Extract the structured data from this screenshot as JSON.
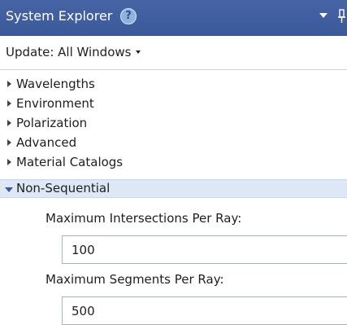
{
  "panel": {
    "title": "System Explorer",
    "help_glyph": "?",
    "icons": [
      "help-icon",
      "dropdown-arrow-icon",
      "pin-icon"
    ]
  },
  "update": {
    "label": "Update: All Windows"
  },
  "tree": {
    "items": [
      {
        "label": "Wavelengths",
        "expanded": false
      },
      {
        "label": "Environment",
        "expanded": false
      },
      {
        "label": "Polarization",
        "expanded": false
      },
      {
        "label": "Advanced",
        "expanded": false
      },
      {
        "label": "Material Catalogs",
        "expanded": false
      },
      {
        "label": "Non-Sequential",
        "expanded": true,
        "selected": true
      }
    ]
  },
  "non_sequential": {
    "max_intersections_label": "Maximum Intersections Per Ray:",
    "max_intersections_value": "100",
    "max_segments_label": "Maximum Segments Per Ray:",
    "max_segments_value": "500"
  },
  "colors": {
    "title_bar": "#3b5a9b",
    "selected_row": "#dde7f6",
    "input_border": "#a7b3c7"
  }
}
